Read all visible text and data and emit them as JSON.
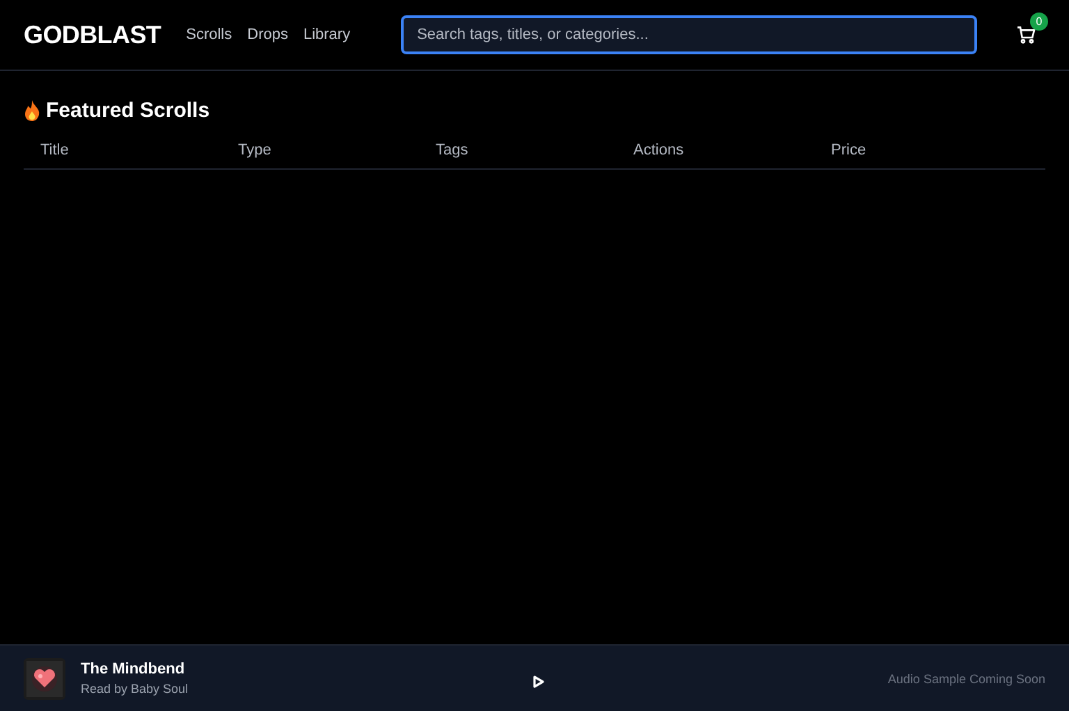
{
  "header": {
    "logo": "GODBLAST",
    "nav": [
      "Scrolls",
      "Drops",
      "Library"
    ],
    "search": {
      "placeholder": "Search tags, titles, or categories..."
    },
    "cart": {
      "count": "0"
    }
  },
  "section": {
    "title": "Featured Scrolls"
  },
  "table": {
    "columns": [
      "Title",
      "Type",
      "Tags",
      "Actions",
      "Price"
    ]
  },
  "player": {
    "title": "The Mindbend",
    "subtitle": "Read by Baby Soul",
    "status": "Audio Sample Coming Soon"
  }
}
